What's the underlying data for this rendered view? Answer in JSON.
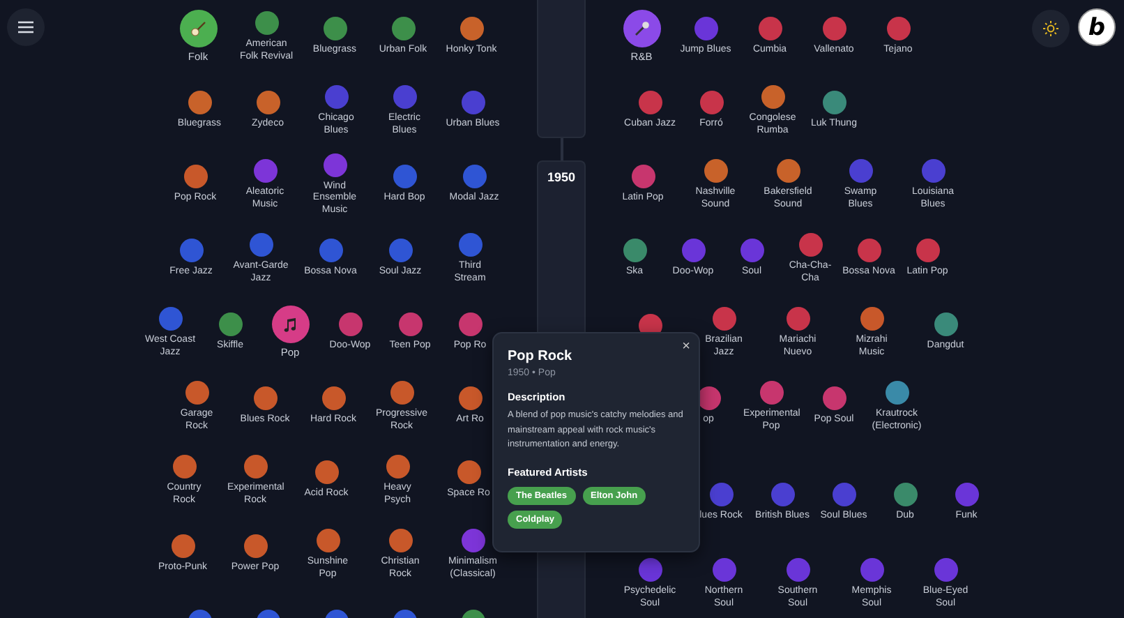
{
  "logo": {
    "text": "b"
  },
  "timeline": {
    "year": "1950"
  },
  "left_rows": [
    {
      "nodes": [
        {
          "label": "Folk",
          "kind": "banjo",
          "color": "#4caf50"
        },
        {
          "label": "American Folk Revival",
          "kind": "dot",
          "color": "#3d8f4a"
        },
        {
          "label": "Bluegrass",
          "kind": "dot",
          "color": "#3d8f4a"
        },
        {
          "label": "Urban Folk",
          "kind": "dot",
          "color": "#3d8f4a"
        },
        {
          "label": "Honky Tonk",
          "kind": "dot",
          "color": "#c8622a"
        }
      ]
    },
    {
      "nodes": [
        {
          "label": "Bluegrass",
          "kind": "dot",
          "color": "#c8622a"
        },
        {
          "label": "Zydeco",
          "kind": "dot",
          "color": "#c8622a"
        },
        {
          "label": "Chicago Blues",
          "kind": "dot",
          "color": "#4a3fd0"
        },
        {
          "label": "Electric Blues",
          "kind": "dot",
          "color": "#4a3fd0"
        },
        {
          "label": "Urban Blues",
          "kind": "dot",
          "color": "#4a3fd0"
        }
      ]
    },
    {
      "nodes": [
        {
          "label": "Pop Rock",
          "kind": "dot",
          "color": "#c8582a"
        },
        {
          "label": "Aleatoric Music",
          "kind": "dot",
          "color": "#7d35d8"
        },
        {
          "label": "Wind Ensemble Music",
          "kind": "dot",
          "color": "#7d35d8"
        },
        {
          "label": "Hard Bop",
          "kind": "dot",
          "color": "#2f55d4"
        },
        {
          "label": "Modal Jazz",
          "kind": "dot",
          "color": "#2f55d4"
        }
      ]
    },
    {
      "nodes": [
        {
          "label": "Free Jazz",
          "kind": "dot",
          "color": "#2f55d4"
        },
        {
          "label": "Avant-Garde Jazz",
          "kind": "dot",
          "color": "#2f55d4"
        },
        {
          "label": "Bossa Nova",
          "kind": "dot",
          "color": "#2f55d4"
        },
        {
          "label": "Soul Jazz",
          "kind": "dot",
          "color": "#2f55d4"
        },
        {
          "label": "Third Stream",
          "kind": "dot",
          "color": "#2f55d4"
        }
      ]
    },
    {
      "nodes": [
        {
          "label": "West Coast Jazz",
          "kind": "dot",
          "color": "#2f55d4"
        },
        {
          "label": "Skiffle",
          "kind": "dot",
          "color": "#3d8f4a"
        },
        {
          "label": "Pop",
          "kind": "note",
          "color": "#d63c87"
        },
        {
          "label": "Doo-Wop",
          "kind": "dot",
          "color": "#c7366e"
        },
        {
          "label": "Teen Pop",
          "kind": "dot",
          "color": "#c7366e"
        },
        {
          "label": "Pop Ro",
          "kind": "dot",
          "color": "#c7366e"
        }
      ]
    },
    {
      "nodes": [
        {
          "label": "Garage Rock",
          "kind": "dot",
          "color": "#c8582a"
        },
        {
          "label": "Blues Rock",
          "kind": "dot",
          "color": "#c8582a"
        },
        {
          "label": "Hard Rock",
          "kind": "dot",
          "color": "#c8582a"
        },
        {
          "label": "Progressive Rock",
          "kind": "dot",
          "color": "#c8582a"
        },
        {
          "label": "Art Ro",
          "kind": "dot",
          "color": "#c8582a"
        }
      ]
    },
    {
      "nodes": [
        {
          "label": "Country Rock",
          "kind": "dot",
          "color": "#c8582a"
        },
        {
          "label": "Experimental Rock",
          "kind": "dot",
          "color": "#c8582a"
        },
        {
          "label": "Acid Rock",
          "kind": "dot",
          "color": "#c8582a"
        },
        {
          "label": "Heavy Psych",
          "kind": "dot",
          "color": "#c8582a"
        },
        {
          "label": "Space Ro",
          "kind": "dot",
          "color": "#c8582a"
        }
      ]
    },
    {
      "nodes": [
        {
          "label": "Proto-Punk",
          "kind": "dot",
          "color": "#c8582a"
        },
        {
          "label": "Power Pop",
          "kind": "dot",
          "color": "#c8582a"
        },
        {
          "label": "Sunshine Pop",
          "kind": "dot",
          "color": "#c8582a"
        },
        {
          "label": "Christian Rock",
          "kind": "dot",
          "color": "#c8582a"
        },
        {
          "label": "Minimalism (Classical)",
          "kind": "dot",
          "color": "#7d35d8"
        }
      ]
    },
    {
      "nodes": [
        {
          "kind": "dot",
          "color": "#2f55d4"
        },
        {
          "kind": "dot",
          "color": "#2f55d4"
        },
        {
          "kind": "dot",
          "color": "#2f55d4"
        },
        {
          "kind": "dot",
          "color": "#2f55d4"
        },
        {
          "kind": "dot",
          "color": "#3d8f4a"
        }
      ]
    }
  ],
  "right_rows": [
    {
      "nodes": [
        {
          "label": "R&B",
          "kind": "mic",
          "color": "#8b4ae8"
        },
        {
          "label": "Jump Blues",
          "kind": "dot",
          "color": "#6a35d8"
        },
        {
          "label": "Cumbia",
          "kind": "dot",
          "color": "#c8344a"
        },
        {
          "label": "Vallenato",
          "kind": "dot",
          "color": "#c8344a"
        },
        {
          "label": "Tejano",
          "kind": "dot",
          "color": "#c8344a"
        }
      ]
    },
    {
      "nodes": [
        {
          "label": "Cuban Jazz",
          "kind": "dot",
          "color": "#c8344a"
        },
        {
          "label": "Forró",
          "kind": "dot",
          "color": "#c8344a"
        },
        {
          "label": "Congolese Rumba",
          "kind": "dot",
          "color": "#c8622a"
        },
        {
          "label": "Luk Thung",
          "kind": "dot",
          "color": "#3a8a7a"
        }
      ]
    },
    {
      "nodes": [
        {
          "label": "Latin Pop",
          "kind": "dot",
          "color": "#c7366e"
        },
        {
          "label": "Nashville Sound",
          "kind": "dot",
          "color": "#c8622a"
        },
        {
          "label": "Bakersfield Sound",
          "kind": "dot",
          "color": "#c8622a"
        },
        {
          "label": "Swamp Blues",
          "kind": "dot",
          "color": "#4a3fd0"
        },
        {
          "label": "Louisiana Blues",
          "kind": "dot",
          "color": "#4a3fd0"
        }
      ]
    },
    {
      "nodes": [
        {
          "label": "Ska",
          "kind": "dot",
          "color": "#3a8a6a"
        },
        {
          "label": "Doo-Wop",
          "kind": "dot",
          "color": "#6a35d8"
        },
        {
          "label": "Soul",
          "kind": "dot",
          "color": "#6a35d8"
        },
        {
          "label": "Cha-Cha-Cha",
          "kind": "dot",
          "color": "#c8344a"
        },
        {
          "label": "Bossa Nova",
          "kind": "dot",
          "color": "#c8344a"
        },
        {
          "label": "Latin Pop",
          "kind": "dot",
          "color": "#c8344a"
        }
      ]
    },
    {
      "nodes": [
        {
          "kind": "dot",
          "color": "#c8344a"
        },
        {
          "label": "Brazilian Jazz",
          "kind": "dot",
          "color": "#c8344a"
        },
        {
          "label": "Mariachi Nuevo",
          "kind": "dot",
          "color": "#c8344a"
        },
        {
          "label": "Mizrahi Music",
          "kind": "dot",
          "color": "#c8582a"
        },
        {
          "label": "Dangdut",
          "kind": "dot",
          "color": "#3a8a7a"
        }
      ]
    },
    {
      "nodes": [
        {
          "label": "op",
          "kind": "dot",
          "color": "#c7366e"
        },
        {
          "label": "Experimental Pop",
          "kind": "dot",
          "color": "#c7366e"
        },
        {
          "label": "Pop Soul",
          "kind": "dot",
          "color": "#c7366e"
        },
        {
          "label": "Krautrock (Electronic)",
          "kind": "dot",
          "color": "#3a8aa8"
        }
      ]
    },
    {
      "nodes": [
        {
          "label": "lues Rock",
          "kind": "dot",
          "color": "#4a3fd0"
        },
        {
          "label": "British Blues",
          "kind": "dot",
          "color": "#4a3fd0"
        },
        {
          "label": "Soul Blues",
          "kind": "dot",
          "color": "#4a3fd0"
        },
        {
          "label": "Dub",
          "kind": "dot",
          "color": "#3a8a6a"
        },
        {
          "label": "Funk",
          "kind": "dot",
          "color": "#6a35d8"
        }
      ]
    },
    {
      "nodes": [
        {
          "label": "Psychedelic Soul",
          "kind": "dot",
          "color": "#6a35d8"
        },
        {
          "label": "Northern Soul",
          "kind": "dot",
          "color": "#6a35d8"
        },
        {
          "label": "Southern Soul",
          "kind": "dot",
          "color": "#6a35d8"
        },
        {
          "label": "Memphis Soul",
          "kind": "dot",
          "color": "#6a35d8"
        },
        {
          "label": "Blue-Eyed Soul",
          "kind": "dot",
          "color": "#6a35d8"
        }
      ]
    }
  ],
  "popup": {
    "title": "Pop Rock",
    "close": "×",
    "meta": "1950 • Pop",
    "description_heading": "Description",
    "description": "A blend of pop music's catchy melodies and mainstream appeal with rock music's instrumentation and energy.",
    "artists_heading": "Featured Artists",
    "artists": [
      "The Beatles",
      "Elton John",
      "Coldplay"
    ]
  }
}
